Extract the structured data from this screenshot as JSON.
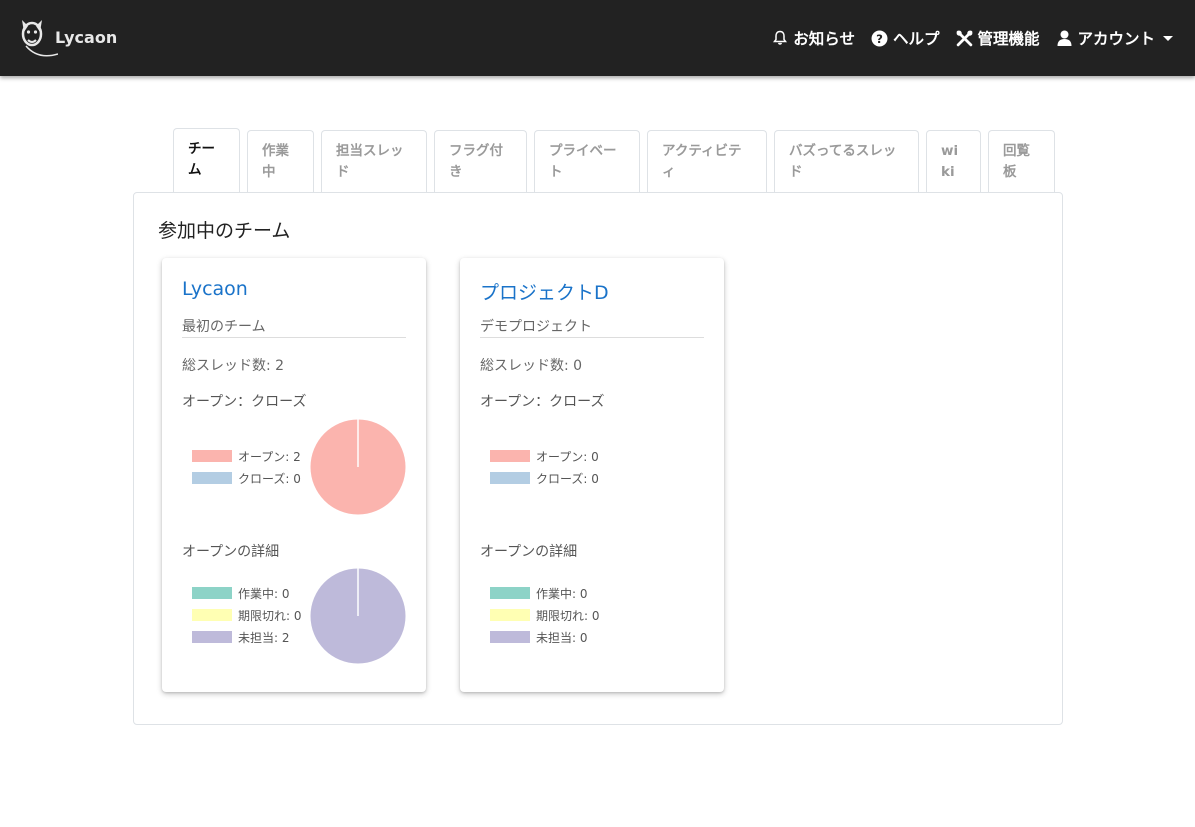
{
  "app": {
    "logo_text": "Lycaon"
  },
  "nav": {
    "notifications": "お知らせ",
    "help": "ヘルプ",
    "admin": "管理機能",
    "account": "アカウント"
  },
  "tabs": [
    {
      "label": "チーム",
      "active": true
    },
    {
      "label": "作業中",
      "active": false
    },
    {
      "label": "担当スレッド",
      "active": false
    },
    {
      "label": "フラグ付き",
      "active": false
    },
    {
      "label": "プライベート",
      "active": false
    },
    {
      "label": "アクティビティ",
      "active": false
    },
    {
      "label": "バズってるスレッド",
      "active": false
    },
    {
      "label": "wiki",
      "active": false
    },
    {
      "label": "回覧板",
      "active": false
    }
  ],
  "main": {
    "title": "参加中のチーム"
  },
  "colors": {
    "open": "#fbb4ae",
    "close": "#b3cde3",
    "working": "#8dd3c7",
    "expired": "#ffffb3",
    "unassigned": "#bebada",
    "link": "#1a73c9",
    "navbar": "#222222"
  },
  "teams": [
    {
      "name": "Lycaon",
      "description": "最初のチーム",
      "thread_count_label": "総スレッド数: 2",
      "open_close_title": "オープン：クローズ",
      "open_legend": "オープン: 2",
      "close_legend": "クローズ: 0",
      "detail_title": "オープンの詳細",
      "working_legend": "作業中: 0",
      "expired_legend": "期限切れ: 0",
      "unassigned_legend": "未担当: 2",
      "open": 2,
      "close": 0,
      "working": 0,
      "expired": 0,
      "unassigned": 2
    },
    {
      "name": "プロジェクトD",
      "description": "デモプロジェクト",
      "thread_count_label": "総スレッド数: 0",
      "open_close_title": "オープン：クローズ",
      "open_legend": "オープン: 0",
      "close_legend": "クローズ: 0",
      "detail_title": "オープンの詳細",
      "working_legend": "作業中: 0",
      "expired_legend": "期限切れ: 0",
      "unassigned_legend": "未担当: 0",
      "open": 0,
      "close": 0,
      "working": 0,
      "expired": 0,
      "unassigned": 0
    }
  ]
}
